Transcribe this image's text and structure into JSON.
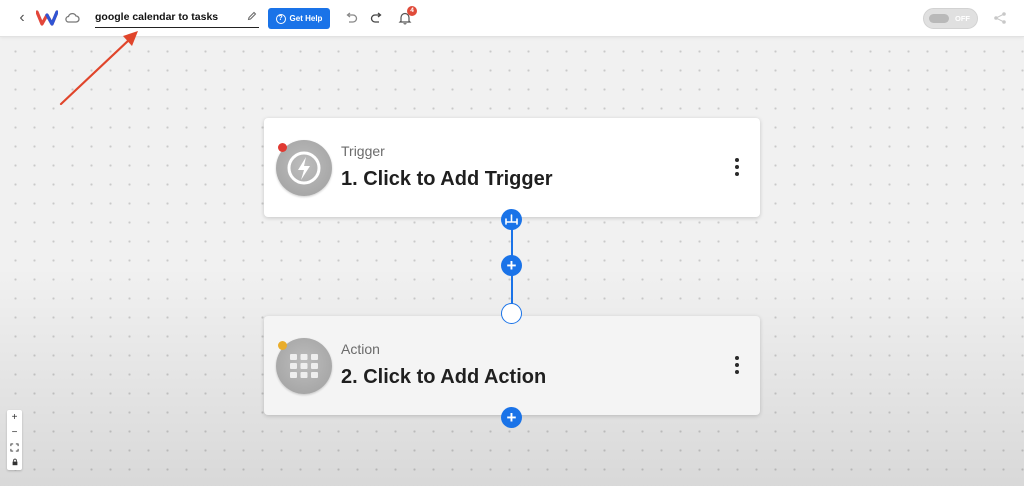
{
  "header": {
    "workflow_name": "google calendar to tasks",
    "help_label": "Get Help",
    "help_icon_glyph": "?",
    "notification_count": "4",
    "toggle_label": "OFF"
  },
  "steps": [
    {
      "type_label": "Trigger",
      "title": "1. Click to Add Trigger",
      "status_color": "#e03a32"
    },
    {
      "type_label": "Action",
      "title": "2. Click to Add Action",
      "status_color": "#e9ad2c"
    }
  ],
  "connector": {
    "add_glyph": "+"
  },
  "zoom_controls": {
    "zoom_in": "+",
    "zoom_out": "−"
  },
  "colors": {
    "accent": "#1a73e8",
    "annotation_arrow": "#e0452b"
  },
  "icons": [
    "back-chevron-icon",
    "logo-icon",
    "cloud-icon",
    "pencil-icon",
    "undo-icon",
    "redo-icon",
    "bell-icon",
    "share-icon",
    "lightning-icon",
    "grid-icon",
    "kebab-menu-icon",
    "fit-view-icon",
    "lock-icon"
  ]
}
